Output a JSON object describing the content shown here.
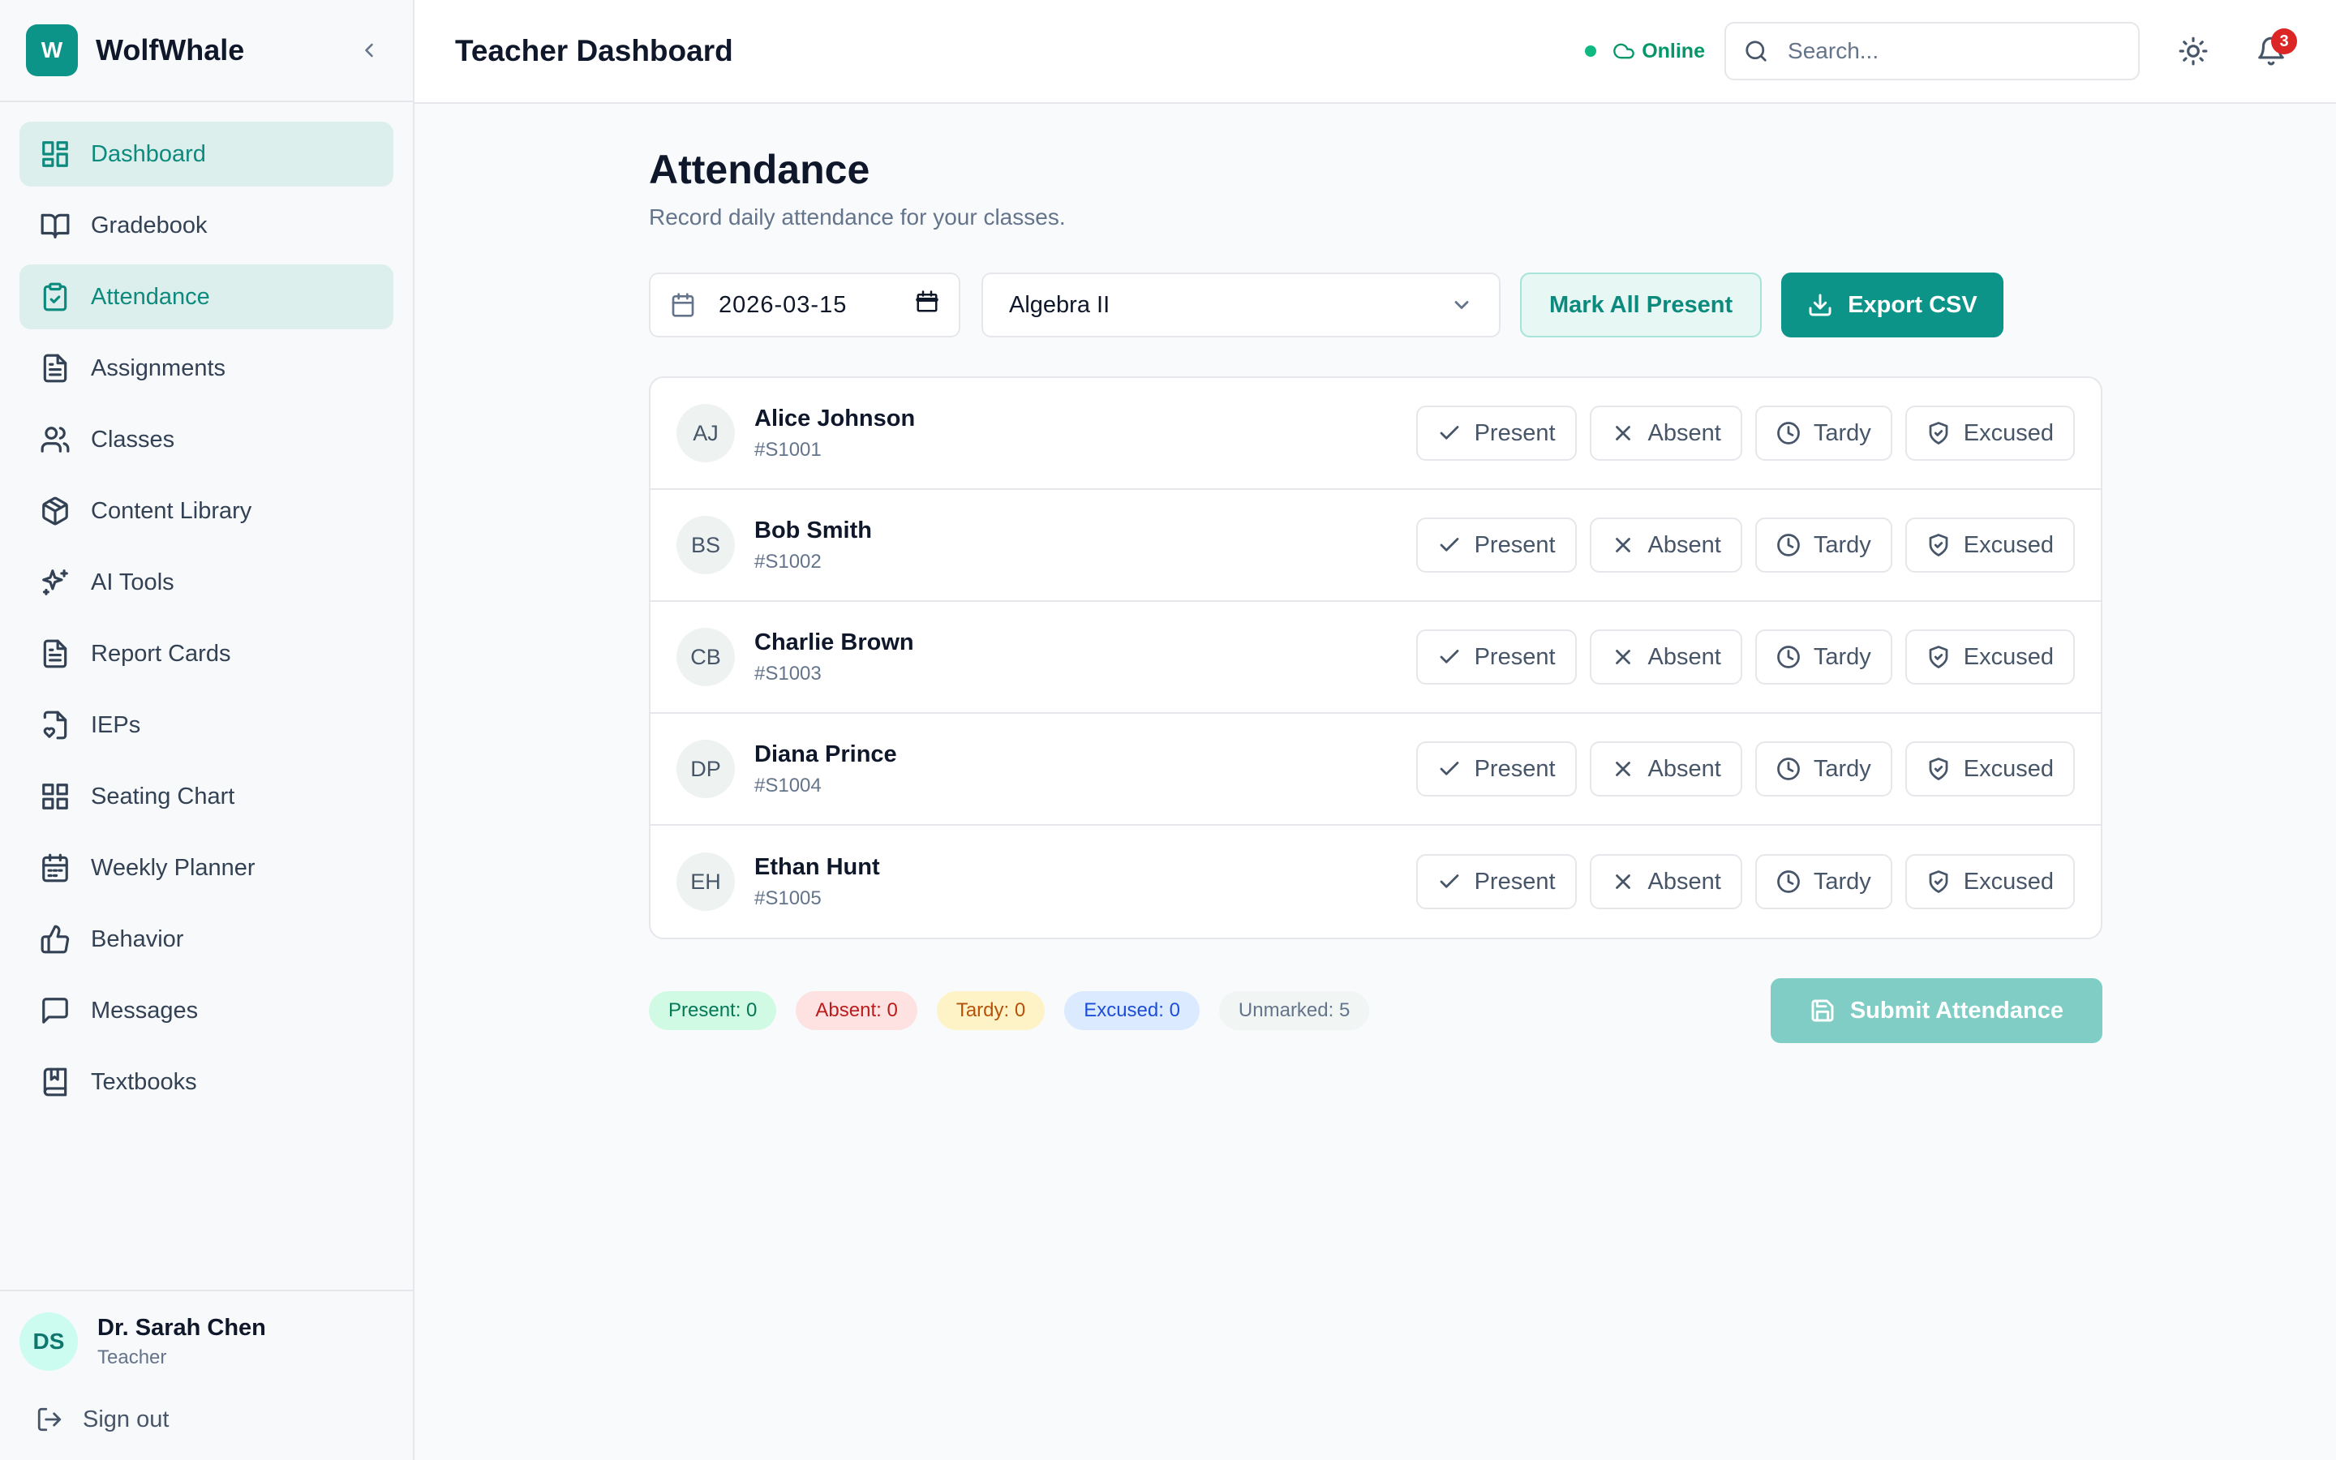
{
  "app": {
    "logo_letter": "W",
    "name": "WolfWhale"
  },
  "sidebar": {
    "items": [
      {
        "label": "Dashboard",
        "icon": "layout-grid-icon",
        "active": true
      },
      {
        "label": "Gradebook",
        "icon": "book-open-icon",
        "active": false
      },
      {
        "label": "Attendance",
        "icon": "clipboard-check-icon",
        "active": true
      },
      {
        "label": "Assignments",
        "icon": "file-text-icon",
        "active": false
      },
      {
        "label": "Classes",
        "icon": "users-icon",
        "active": false
      },
      {
        "label": "Content Library",
        "icon": "package-icon",
        "active": false
      },
      {
        "label": "AI Tools",
        "icon": "sparkles-icon",
        "active": false
      },
      {
        "label": "Report Cards",
        "icon": "file-text-icon",
        "active": false
      },
      {
        "label": "IEPs",
        "icon": "file-heart-icon",
        "active": false
      },
      {
        "label": "Seating Chart",
        "icon": "layout-grid-icon",
        "active": false
      },
      {
        "label": "Weekly Planner",
        "icon": "calendar-icon",
        "active": false
      },
      {
        "label": "Behavior",
        "icon": "thumbs-up-icon",
        "active": false
      },
      {
        "label": "Messages",
        "icon": "message-square-icon",
        "active": false
      },
      {
        "label": "Textbooks",
        "icon": "book-icon",
        "active": false
      }
    ],
    "user": {
      "initials": "DS",
      "name": "Dr. Sarah Chen",
      "role": "Teacher"
    },
    "signout_label": "Sign out"
  },
  "header": {
    "title": "Teacher Dashboard",
    "status_label": "Online",
    "search_placeholder": "Search...",
    "notification_count": "3"
  },
  "main": {
    "title": "Attendance",
    "subtitle": "Record daily attendance for your classes.",
    "date_value": "2026-03-15",
    "class_selected": "Algebra II",
    "mark_all_label": "Mark All Present",
    "export_label": "Export CSV",
    "status_options": [
      "Present",
      "Absent",
      "Tardy",
      "Excused"
    ],
    "students": [
      {
        "initials": "AJ",
        "name": "Alice Johnson",
        "id": "#S1001"
      },
      {
        "initials": "BS",
        "name": "Bob Smith",
        "id": "#S1002"
      },
      {
        "initials": "CB",
        "name": "Charlie Brown",
        "id": "#S1003"
      },
      {
        "initials": "DP",
        "name": "Diana Prince",
        "id": "#S1004"
      },
      {
        "initials": "EH",
        "name": "Ethan Hunt",
        "id": "#S1005"
      }
    ],
    "summary": {
      "present": "Present: 0",
      "absent": "Absent: 0",
      "tardy": "Tardy: 0",
      "excused": "Excused: 0",
      "unmarked": "Unmarked: 5"
    },
    "submit_label": "Submit Attendance"
  },
  "colors": {
    "accent": "#0d9488",
    "accent_soft": "#dcefec",
    "danger": "#dc2626"
  }
}
